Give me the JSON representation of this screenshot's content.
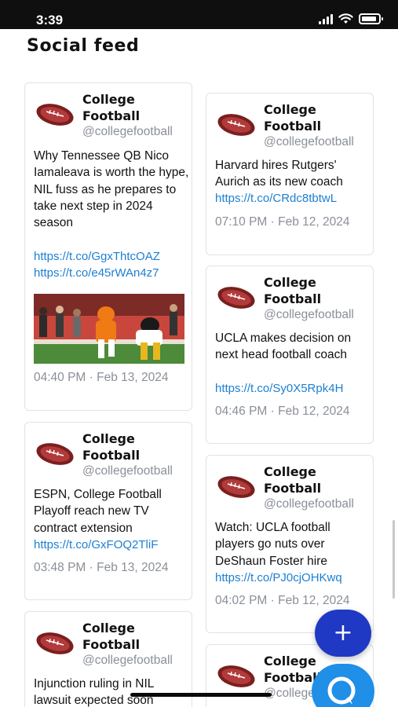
{
  "status_bar": {
    "time": "3:39"
  },
  "page_title": "Social feed",
  "left_column": [
    {
      "author": {
        "name": "College Football",
        "handle": "@collegefootball"
      },
      "text": "Why Tennessee QB Nico Iamaleava is worth the hype, NIL fuss as he prepares to take next step in 2024 season",
      "links": [
        "https://t.co/GgxThtcOAZ",
        "https://t.co/e45rWAn4z7"
      ],
      "time": "04:40 PM · Feb 13, 2024"
    },
    {
      "author": {
        "name": "College Football",
        "handle": "@collegefootball"
      },
      "text": "ESPN, College Football Playoff reach new TV contract extension",
      "links": [
        "https://t.co/GxFOQ2TliF"
      ],
      "time": "03:48 PM · Feb 13, 2024"
    },
    {
      "author": {
        "name": "College Football",
        "handle": "@collegefootball"
      },
      "text": "Injunction ruling in NIL lawsuit expected soon",
      "links": [],
      "time": ""
    }
  ],
  "right_column": [
    {
      "author": {
        "name": "College Football",
        "handle": "@collegefootball"
      },
      "text": "Harvard hires Rutgers' Aurich as its new coach",
      "links": [
        "https://t.co/CRdc8tbtwL"
      ],
      "time": "07:10 PM · Feb 12, 2024"
    },
    {
      "author": {
        "name": "College Football",
        "handle": "@collegefootball"
      },
      "text": "UCLA makes decision on next head football coach",
      "links": [
        "https://t.co/Sy0X5Rpk4H"
      ],
      "time": "04:46 PM · Feb 12, 2024"
    },
    {
      "author": {
        "name": "College Football",
        "handle": "@collegefootball"
      },
      "text": "Watch: UCLA football players go nuts over DeShaun Foster hire",
      "links": [
        "https://t.co/PJ0cjOHKwq"
      ],
      "time": "04:02 PM · Feb 12, 2024"
    },
    {
      "author": {
        "name": "College Football",
        "handle": "@collegefootball"
      },
      "text": "",
      "links": [],
      "time": ""
    }
  ],
  "fab": {
    "add_label": "+"
  },
  "icons": {
    "logo": "football-logo-icon",
    "add": "plus-icon",
    "chat": "chat-bubble-icon"
  },
  "colors": {
    "link": "#1d7fd1",
    "muted": "#8a8f98",
    "fab_add": "#1f39c4",
    "fab_chat": "#1f8fe8"
  }
}
